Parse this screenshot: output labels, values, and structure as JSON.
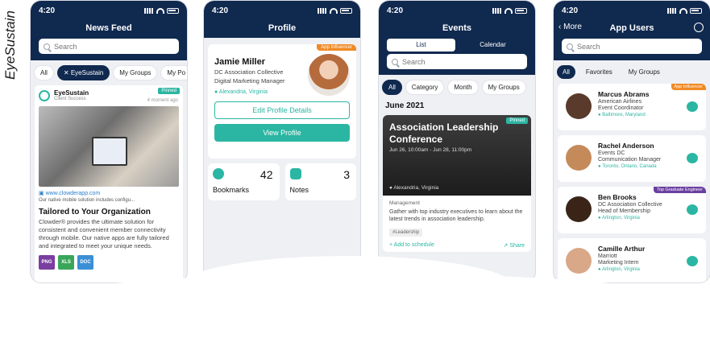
{
  "brand": "EyeSustain",
  "colors": {
    "navy": "#10294f",
    "teal": "#2bb6a3",
    "orange": "#f08a24",
    "purple": "#6b3fa0"
  },
  "status_time": "4:20",
  "search_placeholder": "Search",
  "feed": {
    "title": "News Feed",
    "chips": [
      "All",
      "EyeSustain",
      "My Groups",
      "My Po"
    ],
    "post": {
      "org": "EyeSustain",
      "org_sub": "Client Success",
      "timestamp": "4 moment ago",
      "pinned": "Pinned",
      "link": "www.clowderapp.com",
      "snippet": "Our native mobile solution includes configu...",
      "title": "Tailored to Your Organization",
      "body": "Clowder® provides the ultimate solution for consistent and convenient member connectivity through mobile. Our native apps are fully tailored and integrated to meet your unique needs.",
      "files": [
        {
          "label": "PNG",
          "color": "#7a3ea0"
        },
        {
          "label": "XLS",
          "color": "#3aa65a"
        },
        {
          "label": "DOC",
          "color": "#3b8fd6"
        }
      ]
    }
  },
  "profile": {
    "title": "Profile",
    "badge": "App Influencer",
    "name": "Jamie Miller",
    "org": "DC Association Collective",
    "role": "Digital Marketing Manager",
    "location": "Alexandria, Virginia",
    "edit_label": "Edit Profile Details",
    "view_label": "View Profile",
    "bookmarks": {
      "count": "42",
      "label": "Bookmarks"
    },
    "notes": {
      "count": "3",
      "label": "Notes"
    }
  },
  "events": {
    "title": "Events",
    "segments": [
      "List",
      "Calendar"
    ],
    "chips": [
      "All",
      "Category",
      "Month",
      "My Groups"
    ],
    "month": "June 2021",
    "event": {
      "pinned": "Pinned",
      "title": "Association Leadership Conference",
      "time": "Jun 26, 10:00am - Jun 28, 11:00pm",
      "location": "Alexandria, Virginia",
      "category": "Management",
      "desc": "Gather with top industry executives to learn about the latest trends in association leadership.",
      "tag": "#Leadership",
      "add": "Add to schedule",
      "share": "Share"
    }
  },
  "users": {
    "title": "App Users",
    "back": "More",
    "tabs": [
      "All",
      "Favorites",
      "My Groups"
    ],
    "list": [
      {
        "name": "Marcus Abrams",
        "org": "American Airlines",
        "role": "Event Coordinator",
        "loc": "Baltimore, Maryland",
        "badge": "App Influencer",
        "badge_color": "#f08a24",
        "avatar": "#5a3a2a"
      },
      {
        "name": "Rachel Anderson",
        "org": "Events DC",
        "role": "Communication Manager",
        "loc": "Toronto, Ontario, Canada",
        "badge": "",
        "badge_color": "",
        "avatar": "#c58a5a"
      },
      {
        "name": "Ben Brooks",
        "org": "DC Association Collective",
        "role": "Head of Membership",
        "loc": "Arlington, Virginia",
        "badge": "Top Graduate Engineer",
        "badge_color": "#6b3fa0",
        "avatar": "#3a2418"
      },
      {
        "name": "Camille Arthur",
        "org": "Marriott",
        "role": "Marketing Intern",
        "loc": "Arlington, Virginia",
        "badge": "",
        "badge_color": "",
        "avatar": "#d8a888"
      }
    ]
  }
}
